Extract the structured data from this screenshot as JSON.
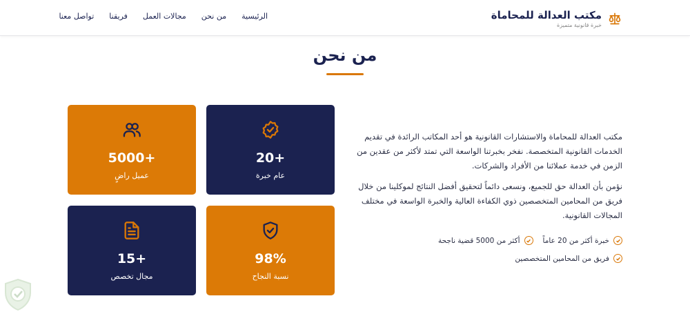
{
  "header": {
    "logo_title": "مكتب العدالة للمحاماة",
    "logo_subtitle": "خبرة قانونية متميزة",
    "logo_icon": "scales-icon",
    "nav": [
      "الرئيسية",
      "من نحن",
      "مجالات العمل",
      "فريقنا",
      "تواصل معنا"
    ]
  },
  "section": {
    "title": "من نحن"
  },
  "about": {
    "paragraph1": "مكتب العدالة للمحاماة والاستشارات القانونية هو أحد المكاتب الرائدة في تقديم الخدمات القانونية المتخصصة. نفخر بخبرتنا الواسعة التي تمتد لأكثر من عقدين من الزمن في خدمة عملائنا من الأفراد والشركات.",
    "paragraph2": "نؤمن بأن العدالة حق للجميع، ونسعى دائماً لتحقيق أفضل النتائج لموكلينا من خلال فريق من المحامين المتخصصين ذوي الكفاءة العالية والخبرة الواسعة في مختلف المجالات القانونية.",
    "features": [
      "خبرة أكثر من 20 عاماً",
      "أكثر من 5000 قضية ناجحة",
      "فريق من المحامين المتخصصين"
    ]
  },
  "stats": [
    {
      "value": "+20",
      "label": "عام خبرة",
      "icon": "badge-check-icon",
      "color": "#1b2250"
    },
    {
      "value": "+5000",
      "label": "عميل راضٍ",
      "icon": "users-icon",
      "color": "#dc7a06"
    },
    {
      "value": "98%",
      "label": "نسبة النجاح",
      "icon": "shield-check-icon",
      "color": "#dc7a06"
    },
    {
      "value": "+15",
      "label": "مجال تخصص",
      "icon": "document-icon",
      "color": "#1b2250"
    }
  ],
  "colors": {
    "accent": "#dc7a06",
    "navy": "#1b2250"
  }
}
